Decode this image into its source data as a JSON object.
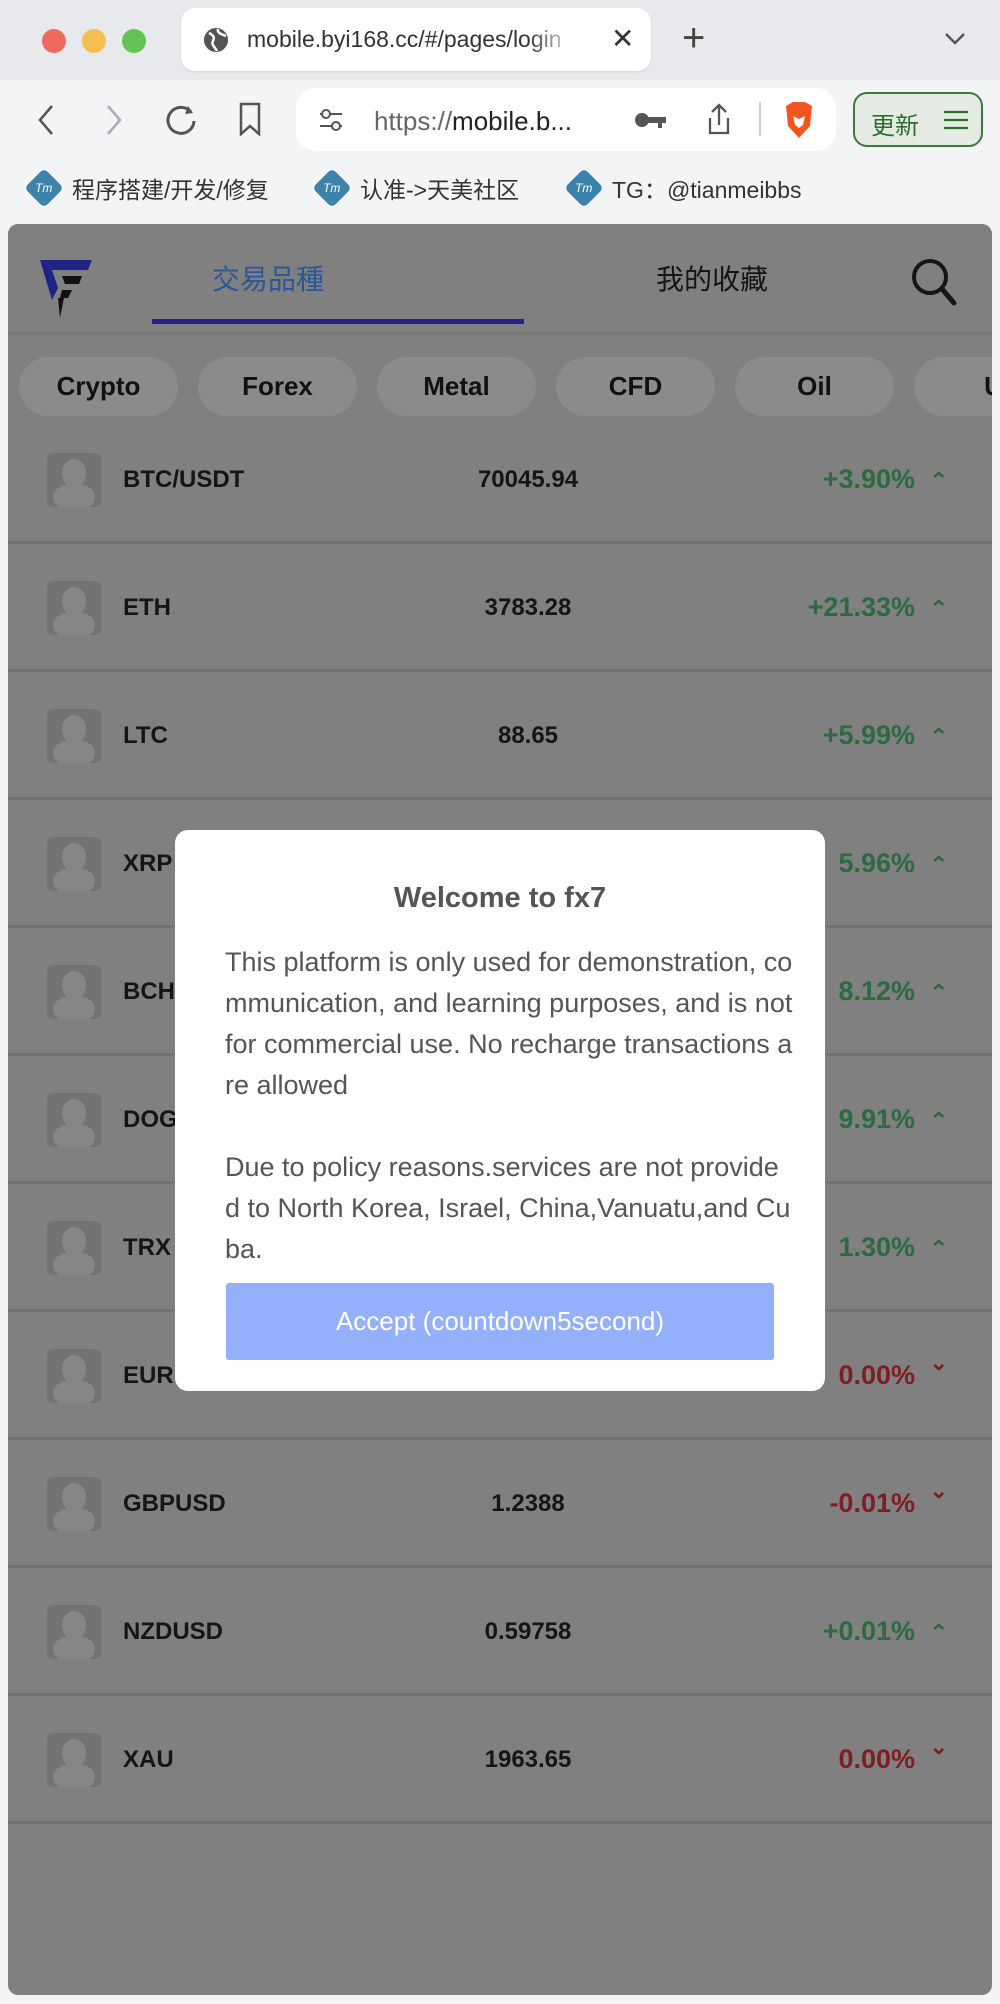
{
  "browser": {
    "tab_title": "mobile.byi168.cc/#/pages/login",
    "url_prefix": "https://",
    "url_host": "mobile.b...",
    "update_label": "更新",
    "bookmarks": [
      {
        "label": "程序搭建/开发/修复",
        "icon": "Tm"
      },
      {
        "label": "认准->天美社区",
        "icon": "Tm"
      },
      {
        "label": "TG：@tianmeibbs",
        "icon": "Tm"
      }
    ]
  },
  "app": {
    "tabs": [
      {
        "label": "交易品種",
        "active": true
      },
      {
        "label": "我的收藏",
        "active": false
      }
    ],
    "categories": [
      "Crypto",
      "Forex",
      "Metal",
      "CFD",
      "Oil",
      "U"
    ],
    "rows": [
      {
        "name": "BTC/USDT",
        "price": "70045.94",
        "change": "+3.90%",
        "dir": "up"
      },
      {
        "name": "ETH",
        "price": "3783.28",
        "change": "+21.33%",
        "dir": "up"
      },
      {
        "name": "LTC",
        "price": "88.65",
        "change": "+5.99%",
        "dir": "up"
      },
      {
        "name": "XRP",
        "price": "",
        "change": "5.96%",
        "dir": "up"
      },
      {
        "name": "BCH",
        "price": "",
        "change": "8.12%",
        "dir": "up"
      },
      {
        "name": "DOG",
        "price": "",
        "change": "9.91%",
        "dir": "up"
      },
      {
        "name": "TRX",
        "price": "",
        "change": "1.30%",
        "dir": "up"
      },
      {
        "name": "EUR",
        "price": "",
        "change": "0.00%",
        "dir": "down"
      },
      {
        "name": "GBPUSD",
        "price": "1.2388",
        "change": "-0.01%",
        "dir": "down"
      },
      {
        "name": "NZDUSD",
        "price": "0.59758",
        "change": "+0.01%",
        "dir": "up"
      },
      {
        "name": "XAU",
        "price": "1963.65",
        "change": "0.00%",
        "dir": "down"
      }
    ]
  },
  "modal": {
    "title": "Welcome to fx7",
    "paragraphs": [
      "This platform is only used for demonstration, communication, and learning purposes, and is not for commercial use. No recharge transactions are allowed",
      "Due to policy reasons.services are not provided to North Korea, Israel, China,Vanuatu,and Cuba."
    ],
    "accept_label": "Accept (countdown5second)"
  },
  "colors": {
    "up": "#2c6a3f",
    "down": "#7e1d22",
    "accept": "#94b0fb",
    "active_tab": "#2c5797",
    "tab_underline": "#23238a"
  }
}
